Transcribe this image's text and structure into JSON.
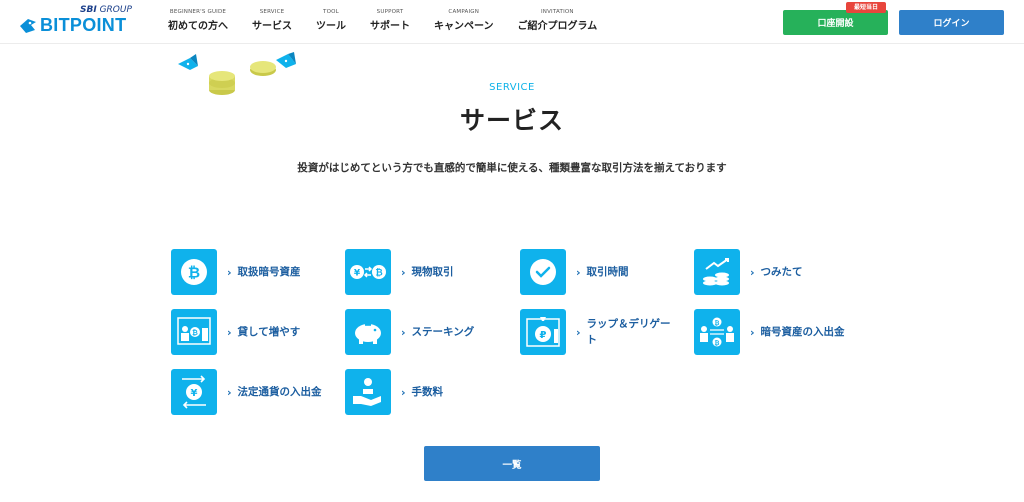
{
  "header": {
    "logo": {
      "group_sbi": "SBI",
      "group_word": "GROUP",
      "name": "BITPOINT"
    },
    "nav": [
      {
        "en": "BEGINNER'S GUIDE",
        "jp": "初めての方へ"
      },
      {
        "en": "SERVICE",
        "jp": "サービス"
      },
      {
        "en": "TOOL",
        "jp": "ツール"
      },
      {
        "en": "SUPPORT",
        "jp": "サポート"
      },
      {
        "en": "CAMPAIGN",
        "jp": "キャンペーン"
      },
      {
        "en": "INVITATION",
        "jp": "ご紹介プログラム"
      }
    ],
    "open_account_label": "口座開設",
    "open_account_badge": "最短当日",
    "login_label": "ログイン"
  },
  "section": {
    "eyebrow": "SERVICE",
    "title": "サービス",
    "subtitle": "投資がはじめてという方でも直感的で簡単に使える、種類豊富な取引方法を揃えております"
  },
  "services": [
    {
      "label": "取扱暗号資産",
      "icon": "bitcoin-icon"
    },
    {
      "label": "現物取引",
      "icon": "yen-bitcoin-exchange-icon"
    },
    {
      "label": "取引時間",
      "icon": "clock-icon"
    },
    {
      "label": "つみたて",
      "icon": "coin-stack-icon"
    },
    {
      "label": "貸して増やす",
      "icon": "lending-icon"
    },
    {
      "label": "ステーキング",
      "icon": "piggy-bank-icon"
    },
    {
      "label": "ラップ＆デリゲート",
      "icon": "wrap-delegate-icon"
    },
    {
      "label": "暗号資産の入出金",
      "icon": "crypto-transfer-icon"
    },
    {
      "label": "法定通貨の入出金",
      "icon": "yen-transfer-icon"
    },
    {
      "label": "手数料",
      "icon": "fee-hand-icon"
    }
  ],
  "list_button_label": "一覧",
  "colors": {
    "accent": "#0fb2ec",
    "primary": "#2f80c9",
    "green": "#26b15a",
    "badge": "#e8453c"
  }
}
